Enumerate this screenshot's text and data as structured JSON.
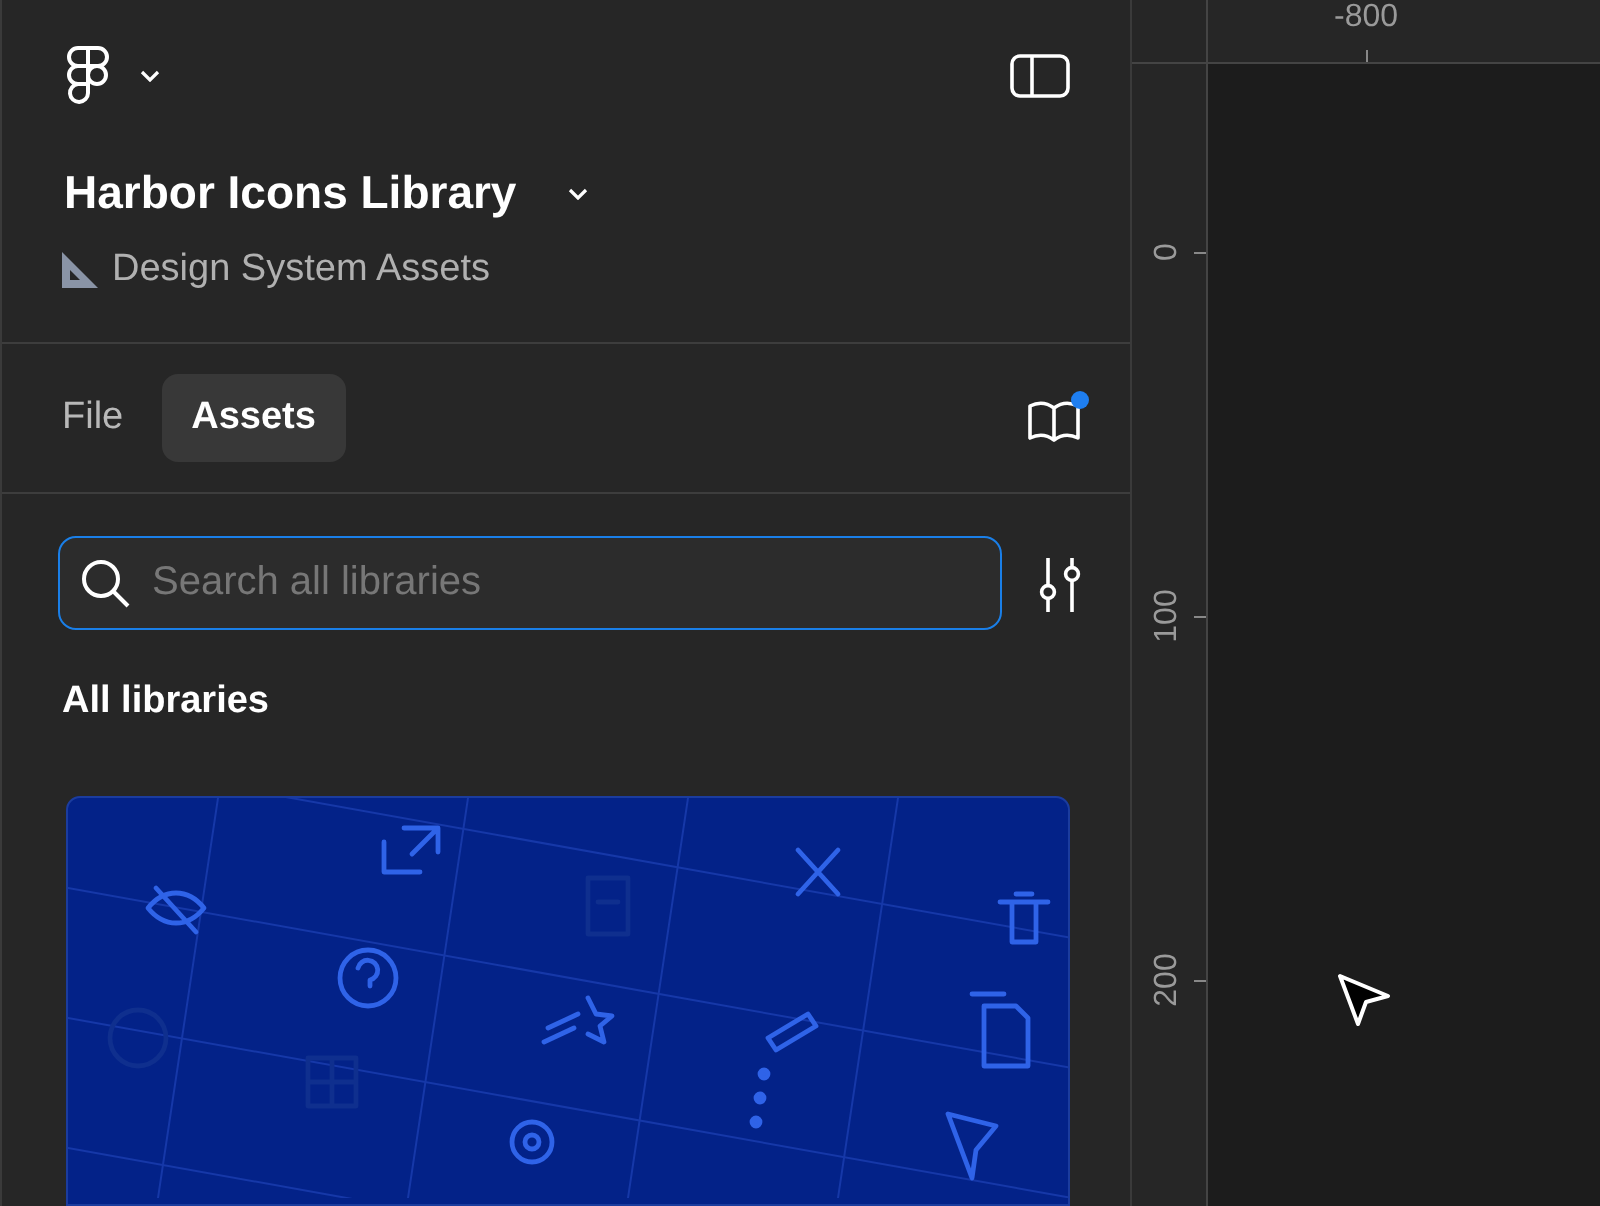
{
  "file": {
    "title": "Harbor Icons Library",
    "project": "Design System Assets"
  },
  "tabs": [
    {
      "label": "File",
      "selected": false
    },
    {
      "label": "Assets",
      "selected": true
    }
  ],
  "library_notice": {
    "unread": true
  },
  "search": {
    "placeholder": "Search all libraries",
    "focused": true
  },
  "section_title": "All libraries",
  "ruler": {
    "horizontal": [
      "-800"
    ],
    "vertical": [
      "0",
      "100",
      "200"
    ]
  }
}
